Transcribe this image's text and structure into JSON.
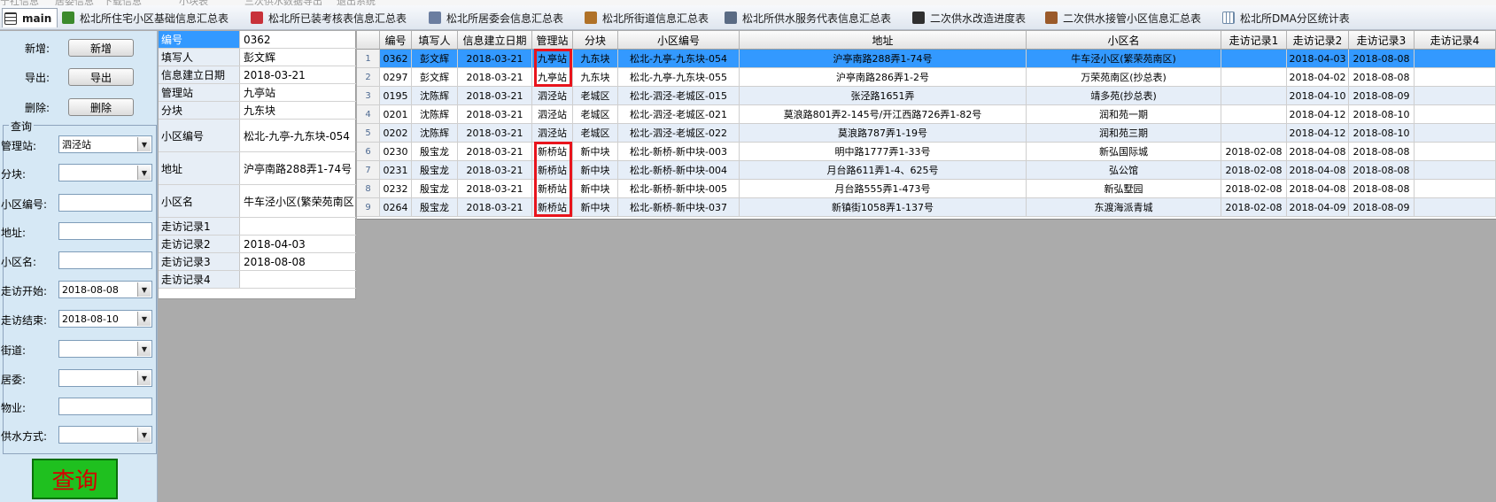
{
  "top_menu_partial": [
    "宁社信息",
    "居委信息",
    "下载信息",
    "小块表",
    "三次供水",
    "数据导出",
    "退出系统"
  ],
  "tabs": [
    {
      "label": "main",
      "icon": "grid-icon",
      "active": true
    },
    {
      "label": "松北所住宅小区基础信息汇总表",
      "icon": "book-icon"
    },
    {
      "label": "松北所已装考核表信息汇总表",
      "icon": "pdf-icon"
    },
    {
      "label": "松北所居委会信息汇总表",
      "icon": "id-card-icon"
    },
    {
      "label": "松北所街道信息汇总表",
      "icon": "house-icon"
    },
    {
      "label": "松北所供水服务代表信息汇总表",
      "icon": "person-icon"
    },
    {
      "label": "二次供水改造进度表",
      "icon": "lightning-icon"
    },
    {
      "label": "二次供水接管小区信息汇总表",
      "icon": "calculator-icon"
    },
    {
      "label": "松北所DMA分区统计表",
      "icon": "table-icon"
    }
  ],
  "left": {
    "add_label": "新增:",
    "add_button": "新增",
    "export_label": "导出:",
    "export_button": "导出",
    "delete_label": "删除:",
    "delete_button": "删除",
    "query_legend": "查询",
    "fields": [
      {
        "label": "管理站:",
        "value": "泗泾站",
        "type": "combo"
      },
      {
        "label": "分块:",
        "value": "",
        "type": "combo"
      },
      {
        "label": "小区编号:",
        "value": "",
        "type": "text"
      },
      {
        "label": "地址:",
        "value": "",
        "type": "text"
      },
      {
        "label": "小区名:",
        "value": "",
        "type": "text"
      },
      {
        "label": "走访开始:",
        "value": "2018-08-08",
        "type": "combo"
      },
      {
        "label": "走访结束:",
        "value": "2018-08-10",
        "type": "combo"
      },
      {
        "label": "街道:",
        "value": "",
        "type": "combo"
      },
      {
        "label": "居委:",
        "value": "",
        "type": "combo"
      },
      {
        "label": "物业:",
        "value": "",
        "type": "text"
      },
      {
        "label": "供水方式:",
        "value": "",
        "type": "combo"
      }
    ],
    "query_button": "查询"
  },
  "detail": [
    {
      "label": "编号",
      "value": "0362"
    },
    {
      "label": "填写人",
      "value": "彭文辉"
    },
    {
      "label": "信息建立日期",
      "value": "2018-03-21"
    },
    {
      "label": "管理站",
      "value": "九亭站"
    },
    {
      "label": "分块",
      "value": "九东块"
    },
    {
      "label": "小区编号",
      "value": "松北-九亭-九东块-054"
    },
    {
      "label": "地址",
      "value": "沪亭南路288弄1-74号"
    },
    {
      "label": "小区名",
      "value": "牛车泾小区(繁荣苑南区"
    },
    {
      "label": "走访记录1",
      "value": ""
    },
    {
      "label": "走访记录2",
      "value": "2018-04-03"
    },
    {
      "label": "走访记录3",
      "value": "2018-08-08"
    },
    {
      "label": "走访记录4",
      "value": ""
    }
  ],
  "grid": {
    "headers": [
      "",
      "编号",
      "填写人",
      "信息建立日期",
      "管理站",
      "分块",
      "小区编号",
      "地址",
      "小区名",
      "走访记录1",
      "走访记录2",
      "走访记录3",
      "走访记录4"
    ],
    "rows": [
      [
        "1",
        "0362",
        "彭文辉",
        "2018-03-21",
        "九亭站",
        "九东块",
        "松北-九亭-九东块-054",
        "沪亭南路288弄1-74号",
        "牛车泾小区(繁荣苑南区)",
        "",
        "2018-04-03",
        "2018-08-08",
        ""
      ],
      [
        "2",
        "0297",
        "彭文辉",
        "2018-03-21",
        "九亭站",
        "九东块",
        "松北-九亭-九东块-055",
        "沪亭南路286弄1-2号",
        "万荣苑南区(抄总表)",
        "",
        "2018-04-02",
        "2018-08-08",
        ""
      ],
      [
        "3",
        "0195",
        "沈陈辉",
        "2018-03-21",
        "泗泾站",
        "老城区",
        "松北-泗泾-老城区-015",
        "张泾路1651弄",
        "靖多苑(抄总表)",
        "",
        "2018-04-10",
        "2018-08-09",
        ""
      ],
      [
        "4",
        "0201",
        "沈陈辉",
        "2018-03-21",
        "泗泾站",
        "老城区",
        "松北-泗泾-老城区-021",
        "莫浪路801弄2-145号/开江西路726弄1-82号",
        "润和苑一期",
        "",
        "2018-04-12",
        "2018-08-10",
        ""
      ],
      [
        "5",
        "0202",
        "沈陈辉",
        "2018-03-21",
        "泗泾站",
        "老城区",
        "松北-泗泾-老城区-022",
        "莫浪路787弄1-19号",
        "润和苑三期",
        "",
        "2018-04-12",
        "2018-08-10",
        ""
      ],
      [
        "6",
        "0230",
        "殷宝龙",
        "2018-03-21",
        "新桥站",
        "新中块",
        "松北-新桥-新中块-003",
        "明中路1777弄1-33号",
        "新弘国际城",
        "2018-02-08",
        "2018-04-08",
        "2018-08-08",
        ""
      ],
      [
        "7",
        "0231",
        "殷宝龙",
        "2018-03-21",
        "新桥站",
        "新中块",
        "松北-新桥-新中块-004",
        "月台路611弄1-4、625号",
        "弘公馆",
        "2018-02-08",
        "2018-04-08",
        "2018-08-08",
        ""
      ],
      [
        "8",
        "0232",
        "殷宝龙",
        "2018-03-21",
        "新桥站",
        "新中块",
        "松北-新桥-新中块-005",
        "月台路555弄1-473号",
        "新弘墅园",
        "2018-02-08",
        "2018-04-08",
        "2018-08-08",
        ""
      ],
      [
        "9",
        "0264",
        "殷宝龙",
        "2018-03-21",
        "新桥站",
        "新中块",
        "松北-新桥-新中块-037",
        "新镇街1058弄1-137号",
        "东渡海派青城",
        "2018-02-08",
        "2018-04-09",
        "2018-08-09",
        ""
      ]
    ]
  },
  "colors": {
    "selection": "#3399ff",
    "row_alt": "#e6eef8",
    "highlight_box": "#e8141c",
    "query_button_bg": "#1fc01f",
    "query_button_text": "#d40000"
  }
}
